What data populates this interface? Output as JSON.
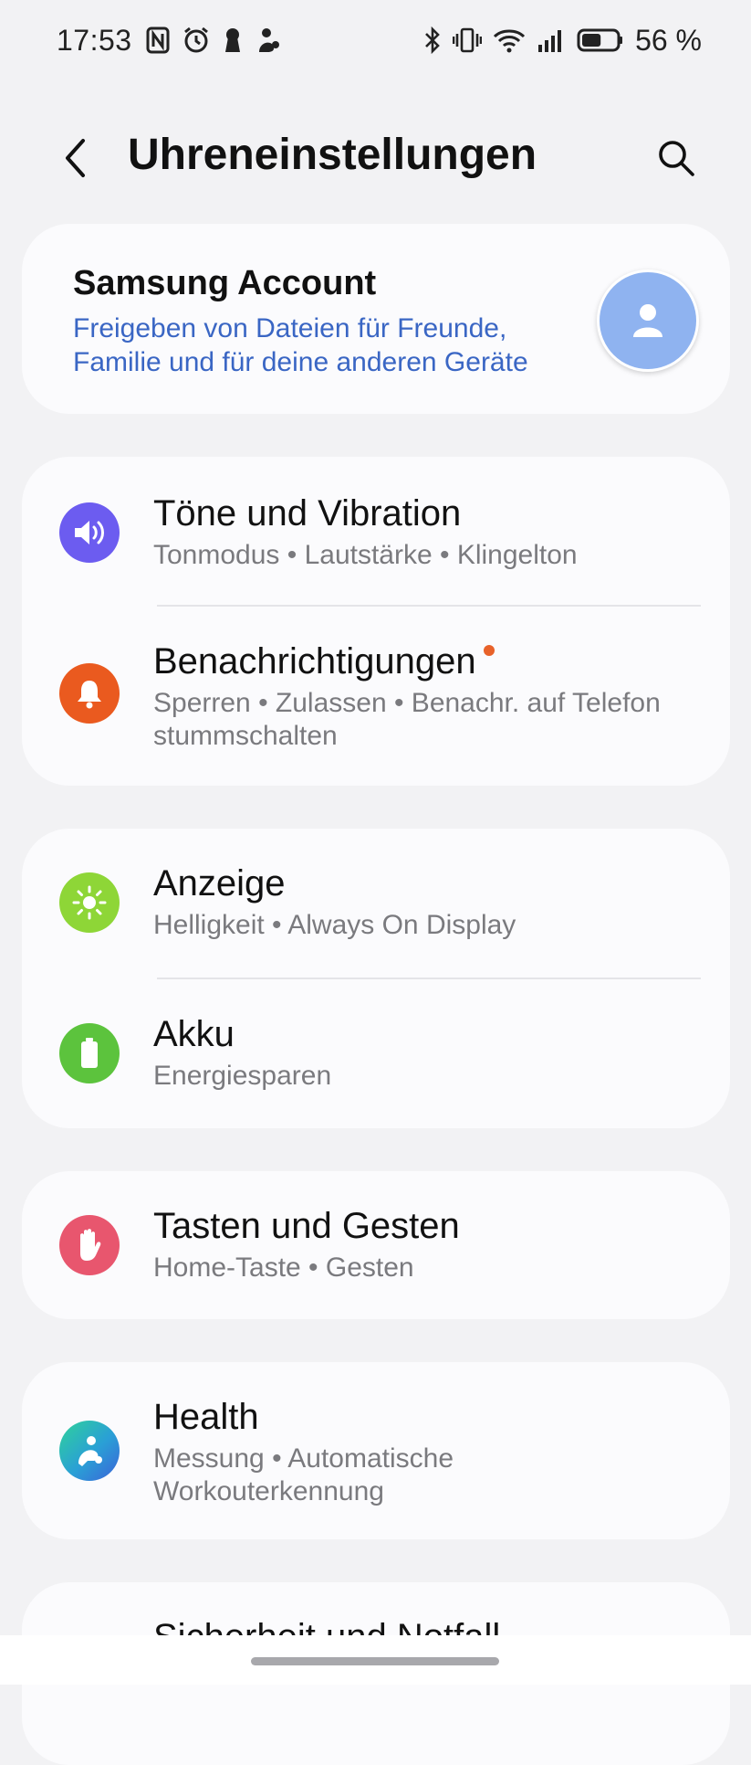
{
  "status_bar": {
    "time": "17:53",
    "left_icons": [
      "nfc-icon",
      "alarm-icon",
      "keyhole-icon",
      "assistant-icon"
    ],
    "right_icons": [
      "bluetooth-icon",
      "vibrate-icon",
      "wifi-icon",
      "signal-icon",
      "battery-icon"
    ],
    "battery_level": 56,
    "battery_text": "56 %"
  },
  "header": {
    "title": "Uhreneinstellungen",
    "back_icon": "chevron-left-icon",
    "search_icon": "search-icon"
  },
  "account": {
    "title": "Samsung Account",
    "subtitle": "Freigeben von Dateien für Freunde, Familie und für deine anderen Geräte",
    "avatar_icon": "person-icon",
    "accent": "#3a66c4"
  },
  "groups": [
    {
      "items": [
        {
          "title": "Töne und Vibration",
          "subtitle": "Tonmodus • Lautstärke • Klingelton",
          "icon": "speaker-icon",
          "color": "#6c5cf0"
        },
        {
          "title": "Benachrichtigungen",
          "subtitle": "Sperren • Zulassen • Benachr. auf Telefon stummschalten",
          "icon": "bell-icon",
          "color": "#ea5a1f",
          "badge": true
        }
      ]
    },
    {
      "items": [
        {
          "title": "Anzeige",
          "subtitle": "Helligkeit • Always On Display",
          "icon": "sun-icon",
          "color": "#8ed637"
        },
        {
          "title": "Akku",
          "subtitle": "Energiesparen",
          "icon": "battery-icon",
          "color": "#5cc33d"
        }
      ]
    },
    {
      "items": [
        {
          "title": "Tasten und Gesten",
          "subtitle": "Home-Taste • Gesten",
          "icon": "hand-icon",
          "color": "#e8566e"
        }
      ]
    },
    {
      "items": [
        {
          "title": "Health",
          "subtitle": "Messung • Automatische Workouterkennung",
          "icon": "health-icon",
          "color": "#2a9fd6"
        }
      ]
    },
    {
      "items": [
        {
          "title": "Sicherheit und Notfall",
          "subtitle": "",
          "icon": "",
          "color": ""
        }
      ]
    }
  ],
  "badge_color": "#e8622a"
}
